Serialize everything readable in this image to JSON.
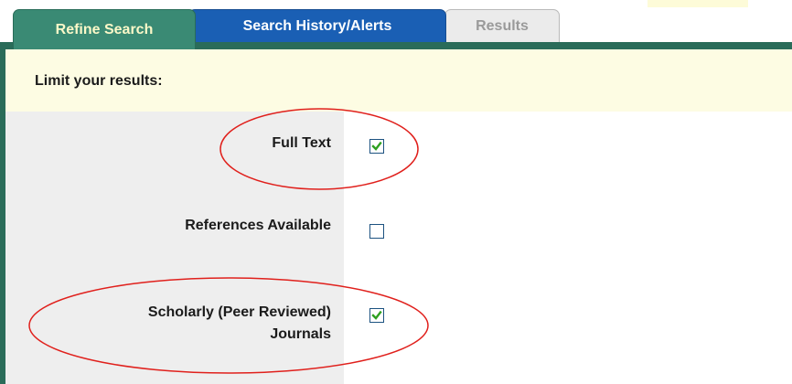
{
  "tabs": [
    {
      "label": "Refine Search",
      "active": true
    },
    {
      "label": "Search History/Alerts",
      "active": false
    },
    {
      "label": "Results",
      "active": false
    }
  ],
  "limit_heading": "Limit your results:",
  "options": [
    {
      "label": "Full Text",
      "checked": true
    },
    {
      "label": "References Available",
      "checked": false
    },
    {
      "label_line1": "Scholarly (Peer Reviewed)",
      "label_line2": "Journals",
      "checked": true
    }
  ],
  "colors": {
    "tab_active_bg": "#3a8a74",
    "tab_active_text": "#fbf8c8",
    "tab_history_bg": "#1a5fb4",
    "tab_inactive_bg": "#ebebeb",
    "frame_border": "#2a6c59",
    "limit_bar_bg": "#fdfce3",
    "left_column_bg": "#eeeeee",
    "check_color": "#2ea020",
    "annotation_circle": "#e0201c"
  }
}
